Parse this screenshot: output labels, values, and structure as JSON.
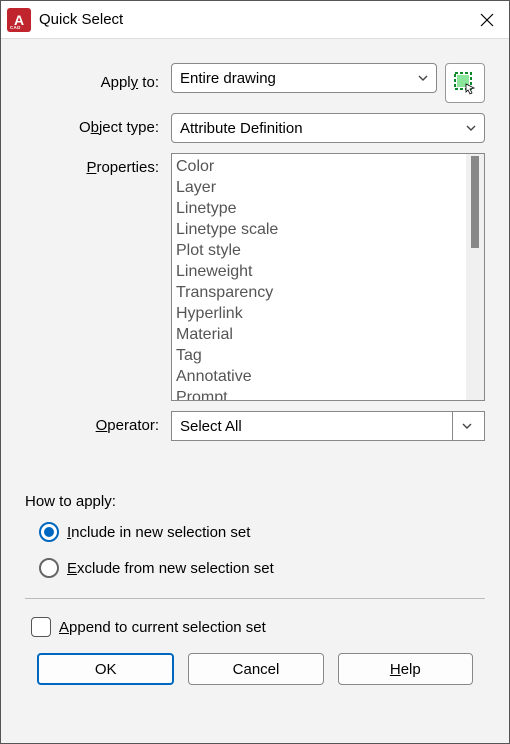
{
  "title": "Quick Select",
  "labels": {
    "apply_to_pre": "Appl",
    "apply_to_ul": "y",
    "apply_to_post": " to:",
    "object_type_pre": "O",
    "object_type_ul": "b",
    "object_type_post": "ject type:",
    "properties_pre": "",
    "properties_ul": "P",
    "properties_post": "roperties:",
    "operator_pre": "",
    "operator_ul": "O",
    "operator_post": "perator:"
  },
  "fields": {
    "apply_to": "Entire drawing",
    "object_type": "Attribute Definition",
    "operator": "Select All"
  },
  "properties_list": [
    "Color",
    "Layer",
    "Linetype",
    "Linetype scale",
    "Plot style",
    "Lineweight",
    "Transparency",
    "Hyperlink",
    "Material",
    "Tag",
    "Annotative",
    "Prompt"
  ],
  "how_to_apply": {
    "title": "How to apply:",
    "include_ul": "I",
    "include_post": "nclude in new selection set",
    "exclude_ul": "E",
    "exclude_post": "xclude from new selection set",
    "selected": "include"
  },
  "append": {
    "ul": "A",
    "post": "ppend to current selection set",
    "checked": false
  },
  "buttons": {
    "ok": "OK",
    "cancel": "Cancel",
    "help_ul": "H",
    "help_post": "elp"
  }
}
